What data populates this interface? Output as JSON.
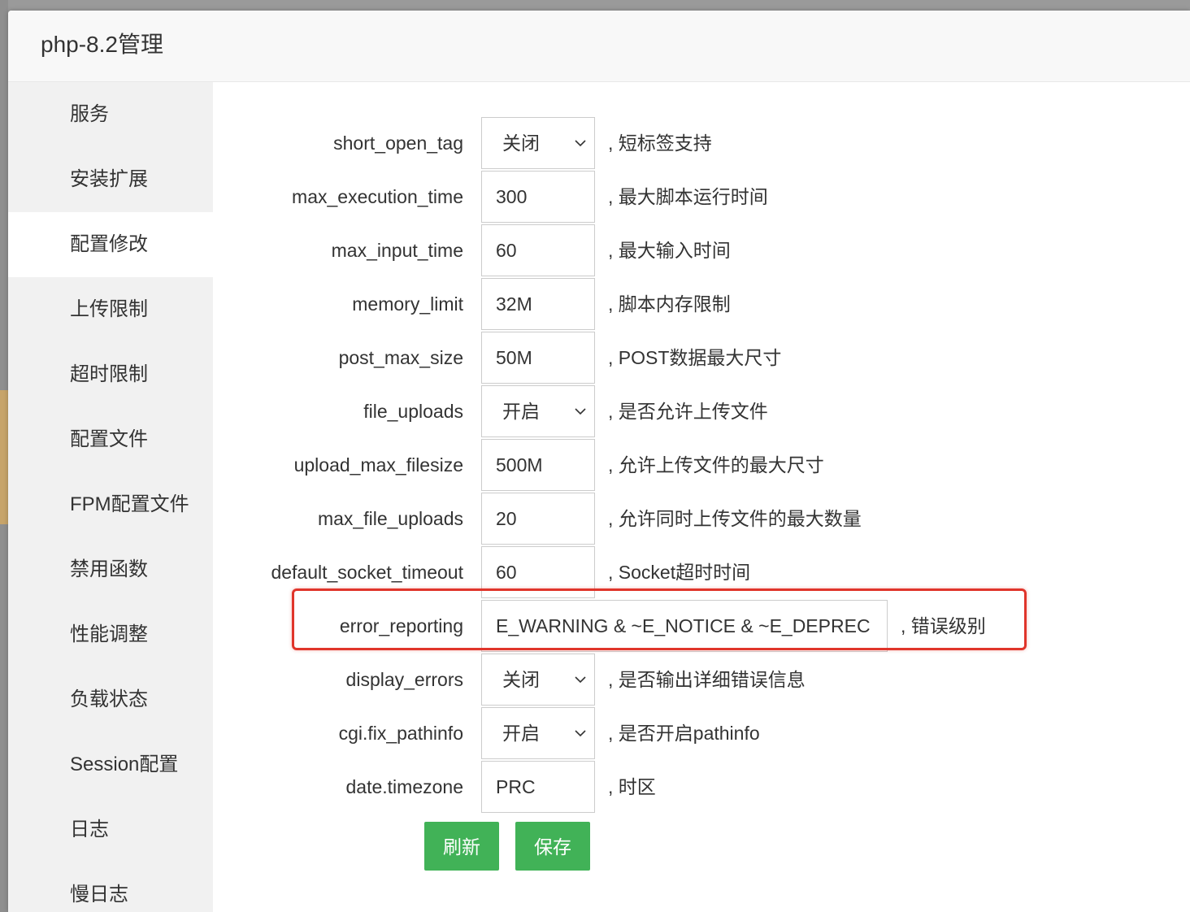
{
  "dialog": {
    "title": "php-8.2管理"
  },
  "sidebar": {
    "items": [
      {
        "label": "服务"
      },
      {
        "label": "安装扩展"
      },
      {
        "label": "配置修改"
      },
      {
        "label": "上传限制"
      },
      {
        "label": "超时限制"
      },
      {
        "label": "配置文件"
      },
      {
        "label": "FPM配置文件"
      },
      {
        "label": "禁用函数"
      },
      {
        "label": "性能调整"
      },
      {
        "label": "负载状态"
      },
      {
        "label": "Session配置"
      },
      {
        "label": "日志"
      },
      {
        "label": "慢日志"
      }
    ],
    "active": "配置修改"
  },
  "settings": [
    {
      "key": "short_open_tag",
      "type": "select",
      "value": "关闭",
      "desc": ", 短标签支持"
    },
    {
      "key": "max_execution_time",
      "type": "input",
      "value": "300",
      "desc": ", 最大脚本运行时间"
    },
    {
      "key": "max_input_time",
      "type": "input",
      "value": "60",
      "desc": ", 最大输入时间"
    },
    {
      "key": "memory_limit",
      "type": "input",
      "value": "32M",
      "desc": ", 脚本内存限制"
    },
    {
      "key": "post_max_size",
      "type": "input",
      "value": "50M",
      "desc": ", POST数据最大尺寸"
    },
    {
      "key": "file_uploads",
      "type": "select",
      "value": "开启",
      "desc": ", 是否允许上传文件"
    },
    {
      "key": "upload_max_filesize",
      "type": "input",
      "value": "500M",
      "desc": ", 允许上传文件的最大尺寸"
    },
    {
      "key": "max_file_uploads",
      "type": "input",
      "value": "20",
      "desc": ", 允许同时上传文件的最大数量"
    },
    {
      "key": "default_socket_timeout",
      "type": "input",
      "value": "60",
      "desc": ", Socket超时时间"
    },
    {
      "key": "error_reporting",
      "type": "input",
      "value": "E_WARNING & ~E_NOTICE & ~E_DEPREC",
      "desc": ", 错误级别"
    },
    {
      "key": "display_errors",
      "type": "select",
      "value": "关闭",
      "desc": ", 是否输出详细错误信息"
    },
    {
      "key": "cgi.fix_pathinfo",
      "type": "select",
      "value": "开启",
      "desc": ", 是否开启pathinfo"
    },
    {
      "key": "date.timezone",
      "type": "input",
      "value": "PRC",
      "desc": ", 时区"
    }
  ],
  "buttons": {
    "refresh": "刷新",
    "save": "保存"
  },
  "colors": {
    "accent_green": "#20a53a",
    "highlight_red": "#e0352b"
  }
}
